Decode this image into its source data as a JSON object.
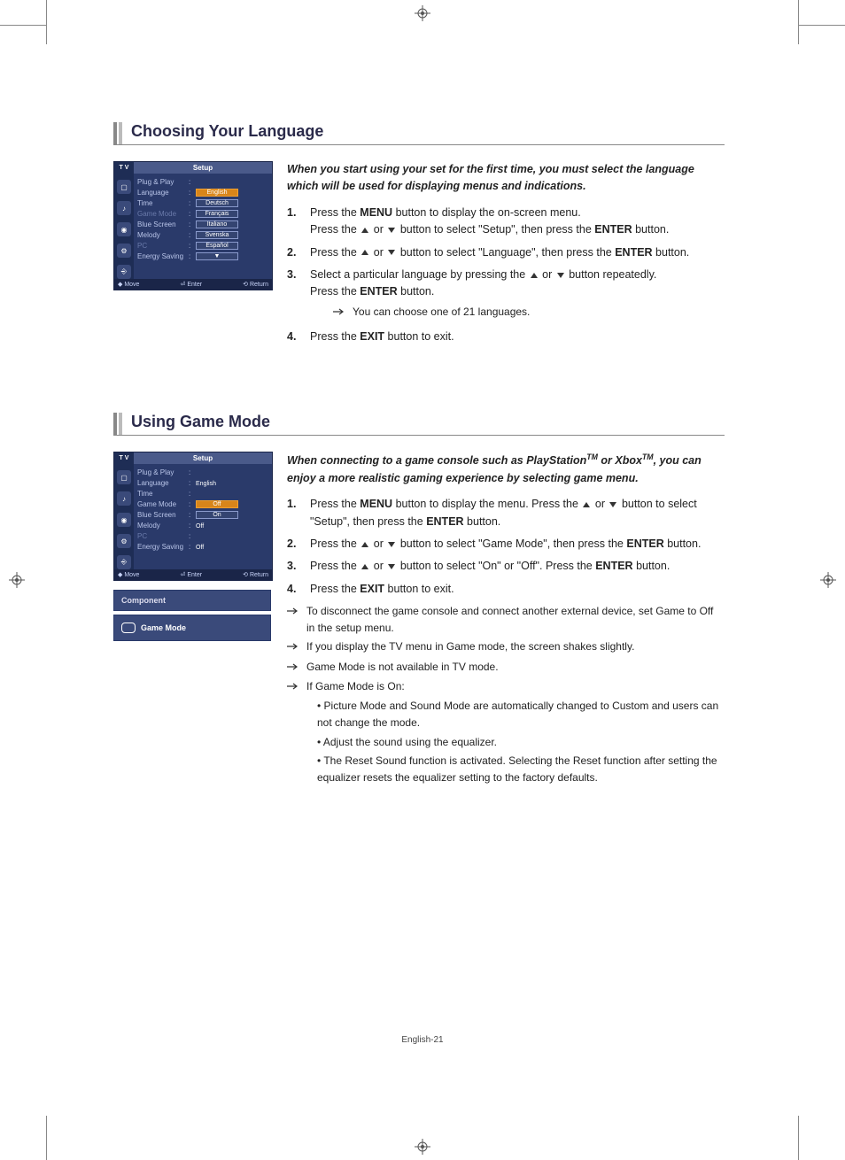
{
  "page_label": "English-21",
  "sections": [
    {
      "title": "Choosing Your Language",
      "intro": "When you start using your set for the first time, you must select the language which will be used for displaying menus and indications.",
      "osd": {
        "header_tv": "T V",
        "title": "Setup",
        "rows": [
          {
            "label": "Plug & Play",
            "value": "",
            "style": "plain"
          },
          {
            "label": "Language",
            "value": "English",
            "style": "sel"
          },
          {
            "label": "Time",
            "value": "Deutsch",
            "style": "box"
          },
          {
            "label": "Game Mode",
            "value": "Français",
            "style": "box",
            "dim": true
          },
          {
            "label": "Blue Screen",
            "value": "Italiano",
            "style": "box"
          },
          {
            "label": "Melody",
            "value": "Svenska",
            "style": "box"
          },
          {
            "label": "PC",
            "value": "Español",
            "style": "box",
            "dim": true
          },
          {
            "label": "Energy Saving",
            "value": "▼",
            "style": "box-arrow"
          }
        ],
        "footer": {
          "move": "Move",
          "enter": "Enter",
          "ret": "Return"
        }
      },
      "steps": [
        {
          "n": "1.",
          "lines": [
            "Press the <b>MENU</b> button to display the on-screen menu.",
            "Press the ▲ or ▼ button to select \"Setup\", then press the <b>ENTER</b> button."
          ]
        },
        {
          "n": "2.",
          "lines": [
            "Press the ▲ or ▼ button to select \"Language\", then press the <b>ENTER</b> button."
          ]
        },
        {
          "n": "3.",
          "lines": [
            "Select a particular language by pressing the ▲ or ▼ button repeatedly.",
            "Press the <b>ENTER</b> button."
          ],
          "notes": [
            "You can choose one of 21 languages."
          ]
        },
        {
          "n": "4.",
          "lines": [
            "Press the <b>EXIT</b> button to exit."
          ]
        }
      ]
    },
    {
      "title": "Using Game Mode",
      "intro": "When connecting to a game console such as PlayStation™ or Xbox™, you can enjoy a more realistic gaming experience by selecting game menu.",
      "osd": {
        "header_tv": "T V",
        "title": "Setup",
        "rows": [
          {
            "label": "Plug & Play",
            "value": "",
            "style": "plain"
          },
          {
            "label": "Language",
            "value": "English",
            "style": "plain-val"
          },
          {
            "label": "Time",
            "value": "",
            "style": "plain"
          },
          {
            "label": "Game Mode",
            "value": "Off",
            "style": "sel"
          },
          {
            "label": "Blue Screen",
            "value": "On",
            "style": "box"
          },
          {
            "label": "Melody",
            "value": "Off",
            "style": "plain-val"
          },
          {
            "label": "PC",
            "value": "",
            "style": "plain",
            "dim": true
          },
          {
            "label": "Energy Saving",
            "value": "Off",
            "style": "plain-val"
          }
        ],
        "footer": {
          "move": "Move",
          "enter": "Enter",
          "ret": "Return"
        }
      },
      "strips": {
        "component": "Component",
        "game_mode": "Game Mode"
      },
      "steps": [
        {
          "n": "1.",
          "lines": [
            "Press the <b>MENU</b> button to display the menu. Press the ▲ or ▼ button to select \"Setup\", then press the <b>ENTER</b> button."
          ]
        },
        {
          "n": "2.",
          "lines": [
            "Press the ▲ or ▼ button to select \"Game Mode\", then press the <b>ENTER</b> button."
          ]
        },
        {
          "n": "3.",
          "lines": [
            "Press the ▲ or ▼ button to select \"On\" or \"Off\". Press the <b>ENTER</b> button."
          ]
        },
        {
          "n": "4.",
          "lines": [
            "Press the <b>EXIT</b> button to exit."
          ]
        }
      ],
      "trailing_notes": [
        "To disconnect the game console and connect another external device, set Game to Off in the setup menu.",
        "If you display the TV menu in Game mode, the screen shakes slightly.",
        "Game Mode is not available in TV mode.",
        "If Game Mode is On:"
      ],
      "sub_bullets": [
        "Picture Mode and Sound Mode are automatically changed to Custom and users can not change the mode.",
        "Adjust the sound using the equalizer.",
        "The Reset Sound function is activated. Selecting the Reset function after setting the equalizer resets the equalizer setting to the factory defaults."
      ]
    }
  ]
}
